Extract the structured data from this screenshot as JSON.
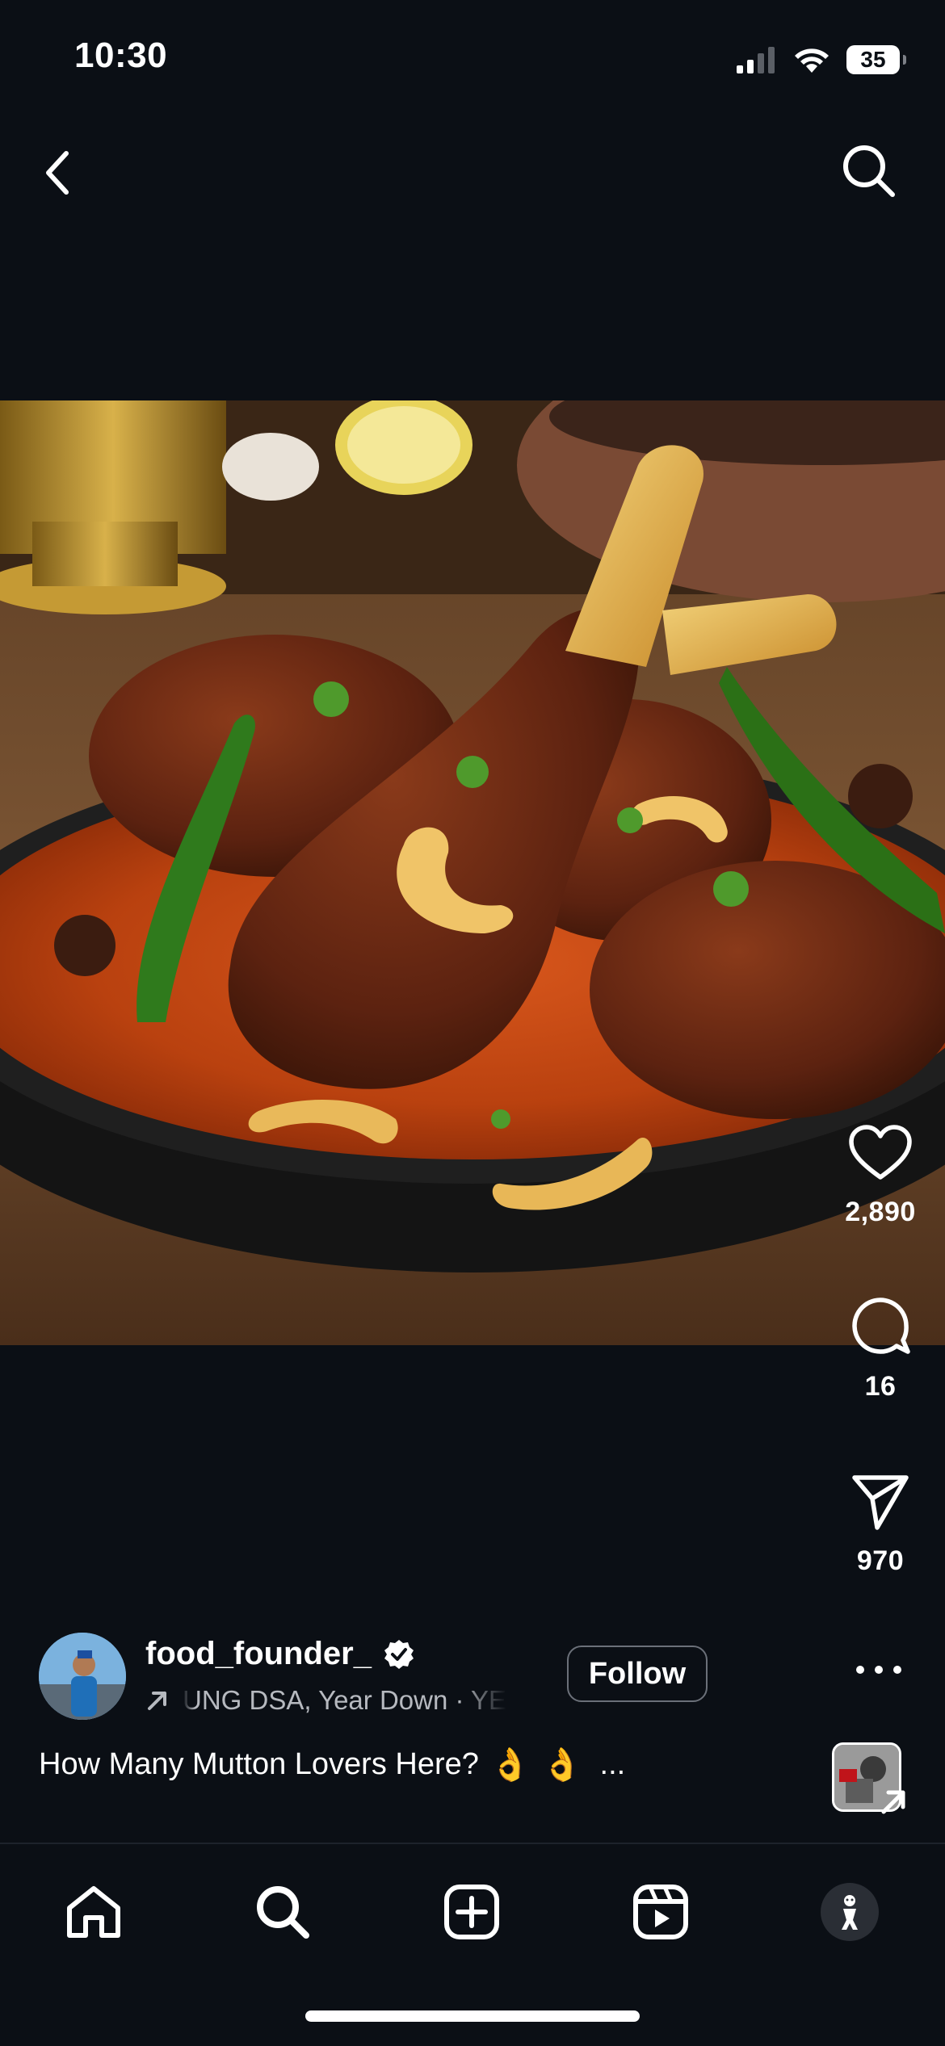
{
  "status_bar": {
    "time": "10:30",
    "battery": "35"
  },
  "top_nav": {
    "back_icon": "chevron-left-icon",
    "search_icon": "search-icon"
  },
  "post": {
    "image_description_icon": "food-photo",
    "likes": "2,890",
    "comments": "16",
    "shares": "970",
    "author": {
      "username": "food_founder_",
      "audio_text": "UNG DSA, Year Down · YE",
      "follow_label": "Follow"
    },
    "caption": {
      "text": "How Many Mutton Lovers Here?",
      "emoji": [
        "👌",
        "👌"
      ],
      "more": "..."
    }
  },
  "tabs": [
    {
      "name": "home",
      "icon": "home-icon"
    },
    {
      "name": "search",
      "icon": "search-icon"
    },
    {
      "name": "create",
      "icon": "plus-square-icon"
    },
    {
      "name": "reels",
      "icon": "reels-icon"
    },
    {
      "name": "profile",
      "icon": "profile-avatar"
    }
  ],
  "colors": {
    "background": "#0b0f15",
    "text": "#ffffff",
    "secondary_text": "#b6b9bf",
    "follow_border": "#6b7079"
  }
}
